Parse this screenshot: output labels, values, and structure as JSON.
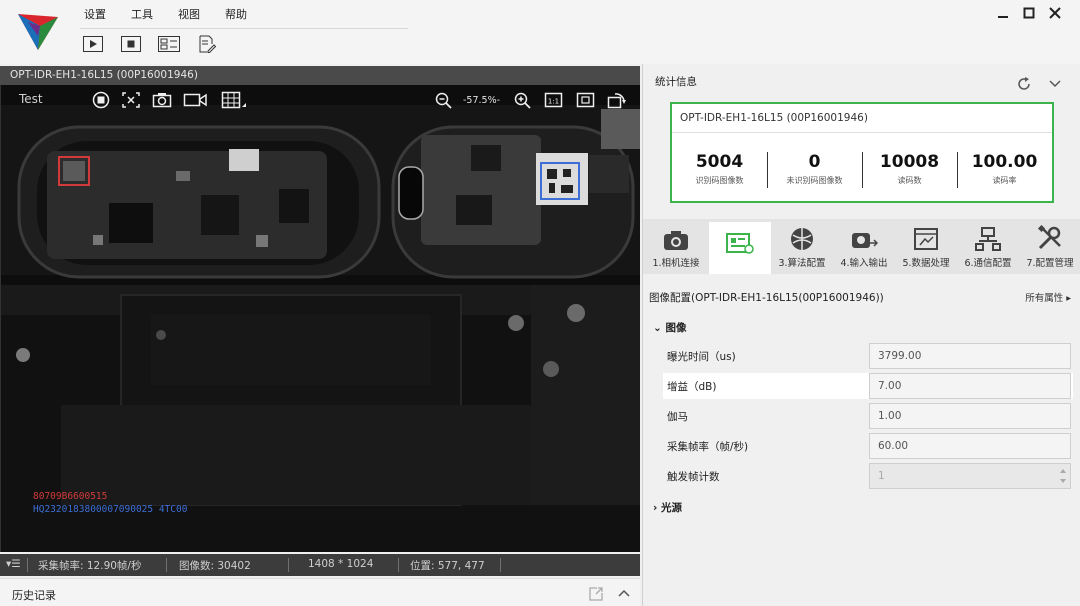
{
  "menu": [
    "设置",
    "工具",
    "视图",
    "帮助"
  ],
  "toolbar": {
    "play": "play-icon",
    "stop": "stop-icon",
    "layout": "layout-icon",
    "edit": "edit-icon"
  },
  "camera": {
    "header": "OPT-IDR-EH1-16L15 (00P16001946)",
    "mode": "Test",
    "zoom": "-57.5%-",
    "codes": {
      "line1": "80709B6600515",
      "line2": "HQ2320183800007090025 4TC00"
    }
  },
  "status": {
    "fps": "采集帧率: 12.90帧/秒",
    "count": "图像数: 30402",
    "resolution": "1408 * 1024",
    "position": "位置: 577, 477"
  },
  "history": {
    "label": "历史记录"
  },
  "stats": {
    "header": "统计信息",
    "device": "OPT-IDR-EH1-16L15 (00P16001946)",
    "items": [
      {
        "value": "5004",
        "label": "识别码图像数"
      },
      {
        "value": "0",
        "label": "未识别码图像数"
      },
      {
        "value": "10008",
        "label": "读码数"
      },
      {
        "value": "100.00",
        "label": "读码率"
      }
    ]
  },
  "tabs": [
    "1.相机连接",
    "",
    "3.算法配置",
    "4.输入输出",
    "5.数据处理",
    "6.通信配置",
    "7.配置管理"
  ],
  "config": {
    "title": "图像配置(OPT-IDR-EH1-16L15(00P16001946))",
    "all_props": "所有属性",
    "group_image": "图像",
    "group_light": "光源",
    "params": [
      {
        "name": "曝光时间（us)",
        "value": "3799.00"
      },
      {
        "name": "增益（dB)",
        "value": "7.00"
      },
      {
        "name": "伽马",
        "value": "1.00"
      },
      {
        "name": "采集帧率（帧/秒)",
        "value": "60.00"
      },
      {
        "name": "触发帧计数",
        "value": "1"
      }
    ]
  },
  "colors": {
    "accent_green": "#3cb44b",
    "code_red": "#d23a3a",
    "code_blue": "#3d6fd6"
  }
}
